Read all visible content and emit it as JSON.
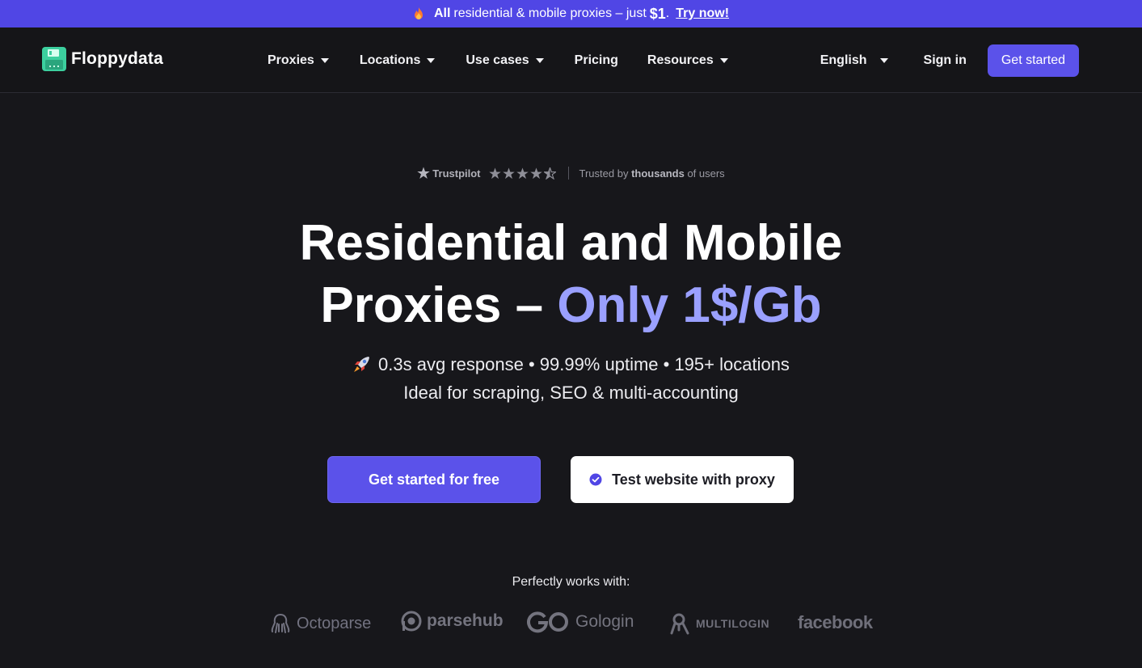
{
  "banner": {
    "bold_lead": "All",
    "text": "residential & mobile proxies – just",
    "price": "$1",
    "period": ".",
    "cta": "Try now!"
  },
  "nav": {
    "logo_text": "Floppydata",
    "menu": [
      {
        "label": "Proxies",
        "has_dropdown": true
      },
      {
        "label": "Locations",
        "has_dropdown": true
      },
      {
        "label": "Use cases",
        "has_dropdown": true
      },
      {
        "label": "Pricing",
        "has_dropdown": false
      },
      {
        "label": "Resources",
        "has_dropdown": true
      }
    ],
    "language": "English",
    "sign_in": "Sign in",
    "get_started": "Get started"
  },
  "hero": {
    "trust": {
      "brand": "Trustpilot",
      "rating_stars": 4.5,
      "prefix": "Trusted by",
      "strong": "thousands",
      "suffix": "of users"
    },
    "headline_line1": "Residential and Mobile",
    "headline_line2_plain": "Proxies –",
    "headline_line2_accent": "Only 1$/Gb",
    "sub_line1": "0.3s avg response • 99.99% uptime • 195+ locations",
    "sub_line2": "Ideal for scraping, SEO & multi-accounting",
    "primary_cta": "Get started for free",
    "secondary_cta": "Test website with proxy"
  },
  "partners": {
    "title": "Perfectly works with:",
    "items": [
      "Octoparse",
      "parsehub",
      "Gologin",
      "MULTILOGIN",
      "facebook"
    ]
  },
  "colors": {
    "background": "#17171b",
    "banner": "#5046e5",
    "primary": "#5b52ea",
    "accent_text": "#9aa0ff"
  }
}
